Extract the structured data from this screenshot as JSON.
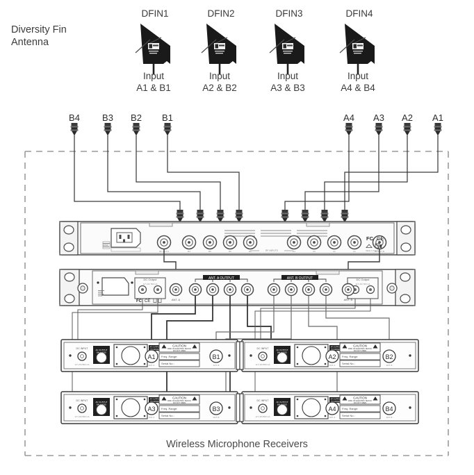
{
  "diagram": {
    "title_left": "Diversity Fin\nAntenna",
    "bottom_caption": "Wireless Microphone Receivers",
    "colors": {
      "line": "#3a3a3a",
      "text": "#3b3b3b",
      "dashed_border": "#9a9a9a",
      "antenna_fill": "#1a1a1a",
      "panel_fill": "#fbfbfb",
      "panel_stroke": "#4a4a4a"
    }
  },
  "antennas": [
    {
      "name": "DFIN1",
      "input_line1": "Input",
      "input_line2": "A1 & B1",
      "logo": "shure-logo"
    },
    {
      "name": "DFIN2",
      "input_line1": "Input",
      "input_line2": "A2 & B2",
      "logo": "shure-logo"
    },
    {
      "name": "DFIN3",
      "input_line1": "Input",
      "input_line2": "A3 & B3",
      "logo": "shure-logo"
    },
    {
      "name": "DFIN4",
      "input_line1": "Input",
      "input_line2": "A4 & B4",
      "logo": "shure-logo"
    }
  ],
  "connector_labels": {
    "b_group": [
      "B4",
      "B3",
      "B2",
      "B1"
    ],
    "a_group": [
      "A4",
      "A3",
      "A2",
      "A1"
    ]
  },
  "unit_antenna_distro": {
    "name": "antenna-distribution-rear-panel",
    "ports_left_label": "RF OUT A",
    "ports_right_label": "RF OUT B",
    "center_label": "RF INPUTS",
    "b_ports": [
      "B4",
      "B3",
      "B2",
      "B1"
    ],
    "a_ports": [
      "A4",
      "A3",
      "A2",
      "A1"
    ],
    "iec_inlet": "AC power inlet",
    "marks": "FC CE",
    "origin": "Made in Taiwan"
  },
  "unit_antenna_splitter": {
    "name": "antenna-splitter-rear-panel",
    "dc_output_left": "DC Output",
    "dc_output_right": "DC Output",
    "ant_a_input": "ANT. A",
    "ant_b_input": "ANT. B",
    "ant_a_output_group": "ANT. A OUTPUT",
    "ant_b_output_group": "ANT. B OUTPUT",
    "marks": "FC CE"
  },
  "receivers": [
    {
      "slot": "top-left",
      "dc_input": "DC INPUT",
      "dc_input_spec": "12 V DC/500 mA",
      "af_output": "AF OUTPUT\nBALANCED",
      "ant_a": "A1",
      "ant_a_label": "ANT. A",
      "ant_b": "B1",
      "ant_b_label": "ANT. B",
      "caution_title": "CAUTION",
      "caution_line1": "RISK OF ELECTRIC SHOCK",
      "caution_line2": "DO NOT OPEN",
      "field_freq": "Freq. Range:",
      "field_serial": "Serial No.:"
    },
    {
      "slot": "top-right",
      "dc_input": "DC INPUT",
      "dc_input_spec": "12 V DC/500 mA",
      "af_output": "AF OUTPUT\nBALANCED",
      "ant_a": "A2",
      "ant_a_label": "ANT. A",
      "ant_b": "B2",
      "ant_b_label": "ANT. B",
      "caution_title": "CAUTION",
      "caution_line1": "RISK OF ELECTRIC SHOCK",
      "caution_line2": "DO NOT OPEN",
      "field_freq": "Freq. Range:",
      "field_serial": "Serial No.:"
    },
    {
      "slot": "bottom-left",
      "dc_input": "DC INPUT",
      "dc_input_spec": "12 V DC/500 mA",
      "af_output": "AF OUTPUT\nBALANCED",
      "ant_a": "A3",
      "ant_a_label": "ANT. A",
      "ant_b": "B3",
      "ant_b_label": "ANT. B",
      "caution_title": "CAUTION",
      "caution_line1": "RISK OF ELECTRIC SHOCK",
      "caution_line2": "DO NOT OPEN",
      "field_freq": "Freq. Range:",
      "field_serial": "Serial No.:"
    },
    {
      "slot": "bottom-right",
      "dc_input": "DC INPUT",
      "dc_input_spec": "12 V DC/500 mA",
      "af_output": "AF OUTPUT\nBALANCED",
      "ant_a": "A4",
      "ant_a_label": "ANT. A",
      "ant_b": "B4",
      "ant_b_label": "ANT. B",
      "caution_title": "CAUTION",
      "caution_line1": "RISK OF ELECTRIC SHOCK",
      "caution_line2": "DO NOT OPEN",
      "field_freq": "Freq. Range:",
      "field_serial": "Serial No.:"
    }
  ]
}
